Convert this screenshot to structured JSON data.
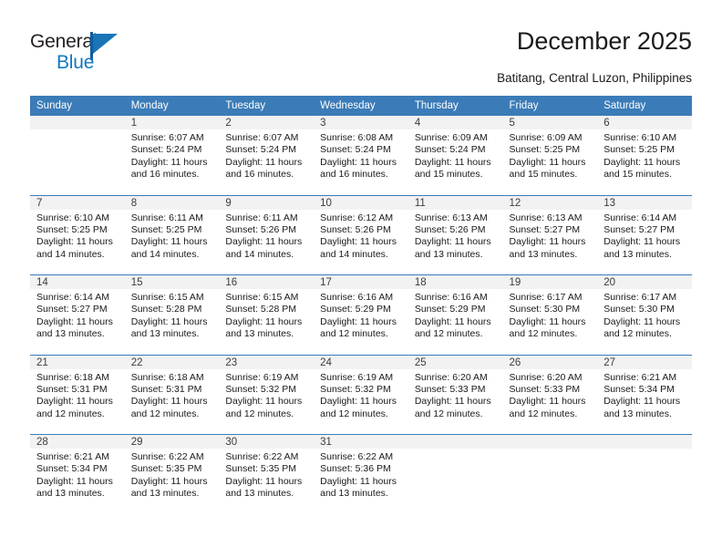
{
  "brand": {
    "name_top": "General",
    "name_bottom": "Blue",
    "flag_icon": "triangle-flag-icon",
    "accent_color": "#1278be",
    "header_color": "#3b7cb8"
  },
  "header": {
    "title": "December 2025",
    "subtitle": "Batitang, Central Luzon, Philippines"
  },
  "calendar": {
    "weekday_headers": [
      "Sunday",
      "Monday",
      "Tuesday",
      "Wednesday",
      "Thursday",
      "Friday",
      "Saturday"
    ],
    "weeks": [
      {
        "days": [
          {
            "num": "",
            "sunrise": "",
            "sunset": "",
            "daylight_1": "",
            "daylight_2": ""
          },
          {
            "num": "1",
            "sunrise": "Sunrise: 6:07 AM",
            "sunset": "Sunset: 5:24 PM",
            "daylight_1": "Daylight: 11 hours",
            "daylight_2": "and 16 minutes."
          },
          {
            "num": "2",
            "sunrise": "Sunrise: 6:07 AM",
            "sunset": "Sunset: 5:24 PM",
            "daylight_1": "Daylight: 11 hours",
            "daylight_2": "and 16 minutes."
          },
          {
            "num": "3",
            "sunrise": "Sunrise: 6:08 AM",
            "sunset": "Sunset: 5:24 PM",
            "daylight_1": "Daylight: 11 hours",
            "daylight_2": "and 16 minutes."
          },
          {
            "num": "4",
            "sunrise": "Sunrise: 6:09 AM",
            "sunset": "Sunset: 5:24 PM",
            "daylight_1": "Daylight: 11 hours",
            "daylight_2": "and 15 minutes."
          },
          {
            "num": "5",
            "sunrise": "Sunrise: 6:09 AM",
            "sunset": "Sunset: 5:25 PM",
            "daylight_1": "Daylight: 11 hours",
            "daylight_2": "and 15 minutes."
          },
          {
            "num": "6",
            "sunrise": "Sunrise: 6:10 AM",
            "sunset": "Sunset: 5:25 PM",
            "daylight_1": "Daylight: 11 hours",
            "daylight_2": "and 15 minutes."
          }
        ]
      },
      {
        "days": [
          {
            "num": "7",
            "sunrise": "Sunrise: 6:10 AM",
            "sunset": "Sunset: 5:25 PM",
            "daylight_1": "Daylight: 11 hours",
            "daylight_2": "and 14 minutes."
          },
          {
            "num": "8",
            "sunrise": "Sunrise: 6:11 AM",
            "sunset": "Sunset: 5:25 PM",
            "daylight_1": "Daylight: 11 hours",
            "daylight_2": "and 14 minutes."
          },
          {
            "num": "9",
            "sunrise": "Sunrise: 6:11 AM",
            "sunset": "Sunset: 5:26 PM",
            "daylight_1": "Daylight: 11 hours",
            "daylight_2": "and 14 minutes."
          },
          {
            "num": "10",
            "sunrise": "Sunrise: 6:12 AM",
            "sunset": "Sunset: 5:26 PM",
            "daylight_1": "Daylight: 11 hours",
            "daylight_2": "and 14 minutes."
          },
          {
            "num": "11",
            "sunrise": "Sunrise: 6:13 AM",
            "sunset": "Sunset: 5:26 PM",
            "daylight_1": "Daylight: 11 hours",
            "daylight_2": "and 13 minutes."
          },
          {
            "num": "12",
            "sunrise": "Sunrise: 6:13 AM",
            "sunset": "Sunset: 5:27 PM",
            "daylight_1": "Daylight: 11 hours",
            "daylight_2": "and 13 minutes."
          },
          {
            "num": "13",
            "sunrise": "Sunrise: 6:14 AM",
            "sunset": "Sunset: 5:27 PM",
            "daylight_1": "Daylight: 11 hours",
            "daylight_2": "and 13 minutes."
          }
        ]
      },
      {
        "days": [
          {
            "num": "14",
            "sunrise": "Sunrise: 6:14 AM",
            "sunset": "Sunset: 5:27 PM",
            "daylight_1": "Daylight: 11 hours",
            "daylight_2": "and 13 minutes."
          },
          {
            "num": "15",
            "sunrise": "Sunrise: 6:15 AM",
            "sunset": "Sunset: 5:28 PM",
            "daylight_1": "Daylight: 11 hours",
            "daylight_2": "and 13 minutes."
          },
          {
            "num": "16",
            "sunrise": "Sunrise: 6:15 AM",
            "sunset": "Sunset: 5:28 PM",
            "daylight_1": "Daylight: 11 hours",
            "daylight_2": "and 13 minutes."
          },
          {
            "num": "17",
            "sunrise": "Sunrise: 6:16 AM",
            "sunset": "Sunset: 5:29 PM",
            "daylight_1": "Daylight: 11 hours",
            "daylight_2": "and 12 minutes."
          },
          {
            "num": "18",
            "sunrise": "Sunrise: 6:16 AM",
            "sunset": "Sunset: 5:29 PM",
            "daylight_1": "Daylight: 11 hours",
            "daylight_2": "and 12 minutes."
          },
          {
            "num": "19",
            "sunrise": "Sunrise: 6:17 AM",
            "sunset": "Sunset: 5:30 PM",
            "daylight_1": "Daylight: 11 hours",
            "daylight_2": "and 12 minutes."
          },
          {
            "num": "20",
            "sunrise": "Sunrise: 6:17 AM",
            "sunset": "Sunset: 5:30 PM",
            "daylight_1": "Daylight: 11 hours",
            "daylight_2": "and 12 minutes."
          }
        ]
      },
      {
        "days": [
          {
            "num": "21",
            "sunrise": "Sunrise: 6:18 AM",
            "sunset": "Sunset: 5:31 PM",
            "daylight_1": "Daylight: 11 hours",
            "daylight_2": "and 12 minutes."
          },
          {
            "num": "22",
            "sunrise": "Sunrise: 6:18 AM",
            "sunset": "Sunset: 5:31 PM",
            "daylight_1": "Daylight: 11 hours",
            "daylight_2": "and 12 minutes."
          },
          {
            "num": "23",
            "sunrise": "Sunrise: 6:19 AM",
            "sunset": "Sunset: 5:32 PM",
            "daylight_1": "Daylight: 11 hours",
            "daylight_2": "and 12 minutes."
          },
          {
            "num": "24",
            "sunrise": "Sunrise: 6:19 AM",
            "sunset": "Sunset: 5:32 PM",
            "daylight_1": "Daylight: 11 hours",
            "daylight_2": "and 12 minutes."
          },
          {
            "num": "25",
            "sunrise": "Sunrise: 6:20 AM",
            "sunset": "Sunset: 5:33 PM",
            "daylight_1": "Daylight: 11 hours",
            "daylight_2": "and 12 minutes."
          },
          {
            "num": "26",
            "sunrise": "Sunrise: 6:20 AM",
            "sunset": "Sunset: 5:33 PM",
            "daylight_1": "Daylight: 11 hours",
            "daylight_2": "and 12 minutes."
          },
          {
            "num": "27",
            "sunrise": "Sunrise: 6:21 AM",
            "sunset": "Sunset: 5:34 PM",
            "daylight_1": "Daylight: 11 hours",
            "daylight_2": "and 13 minutes."
          }
        ]
      },
      {
        "days": [
          {
            "num": "28",
            "sunrise": "Sunrise: 6:21 AM",
            "sunset": "Sunset: 5:34 PM",
            "daylight_1": "Daylight: 11 hours",
            "daylight_2": "and 13 minutes."
          },
          {
            "num": "29",
            "sunrise": "Sunrise: 6:22 AM",
            "sunset": "Sunset: 5:35 PM",
            "daylight_1": "Daylight: 11 hours",
            "daylight_2": "and 13 minutes."
          },
          {
            "num": "30",
            "sunrise": "Sunrise: 6:22 AM",
            "sunset": "Sunset: 5:35 PM",
            "daylight_1": "Daylight: 11 hours",
            "daylight_2": "and 13 minutes."
          },
          {
            "num": "31",
            "sunrise": "Sunrise: 6:22 AM",
            "sunset": "Sunset: 5:36 PM",
            "daylight_1": "Daylight: 11 hours",
            "daylight_2": "and 13 minutes."
          },
          {
            "num": "",
            "sunrise": "",
            "sunset": "",
            "daylight_1": "",
            "daylight_2": ""
          },
          {
            "num": "",
            "sunrise": "",
            "sunset": "",
            "daylight_1": "",
            "daylight_2": ""
          },
          {
            "num": "",
            "sunrise": "",
            "sunset": "",
            "daylight_1": "",
            "daylight_2": ""
          }
        ]
      }
    ]
  }
}
